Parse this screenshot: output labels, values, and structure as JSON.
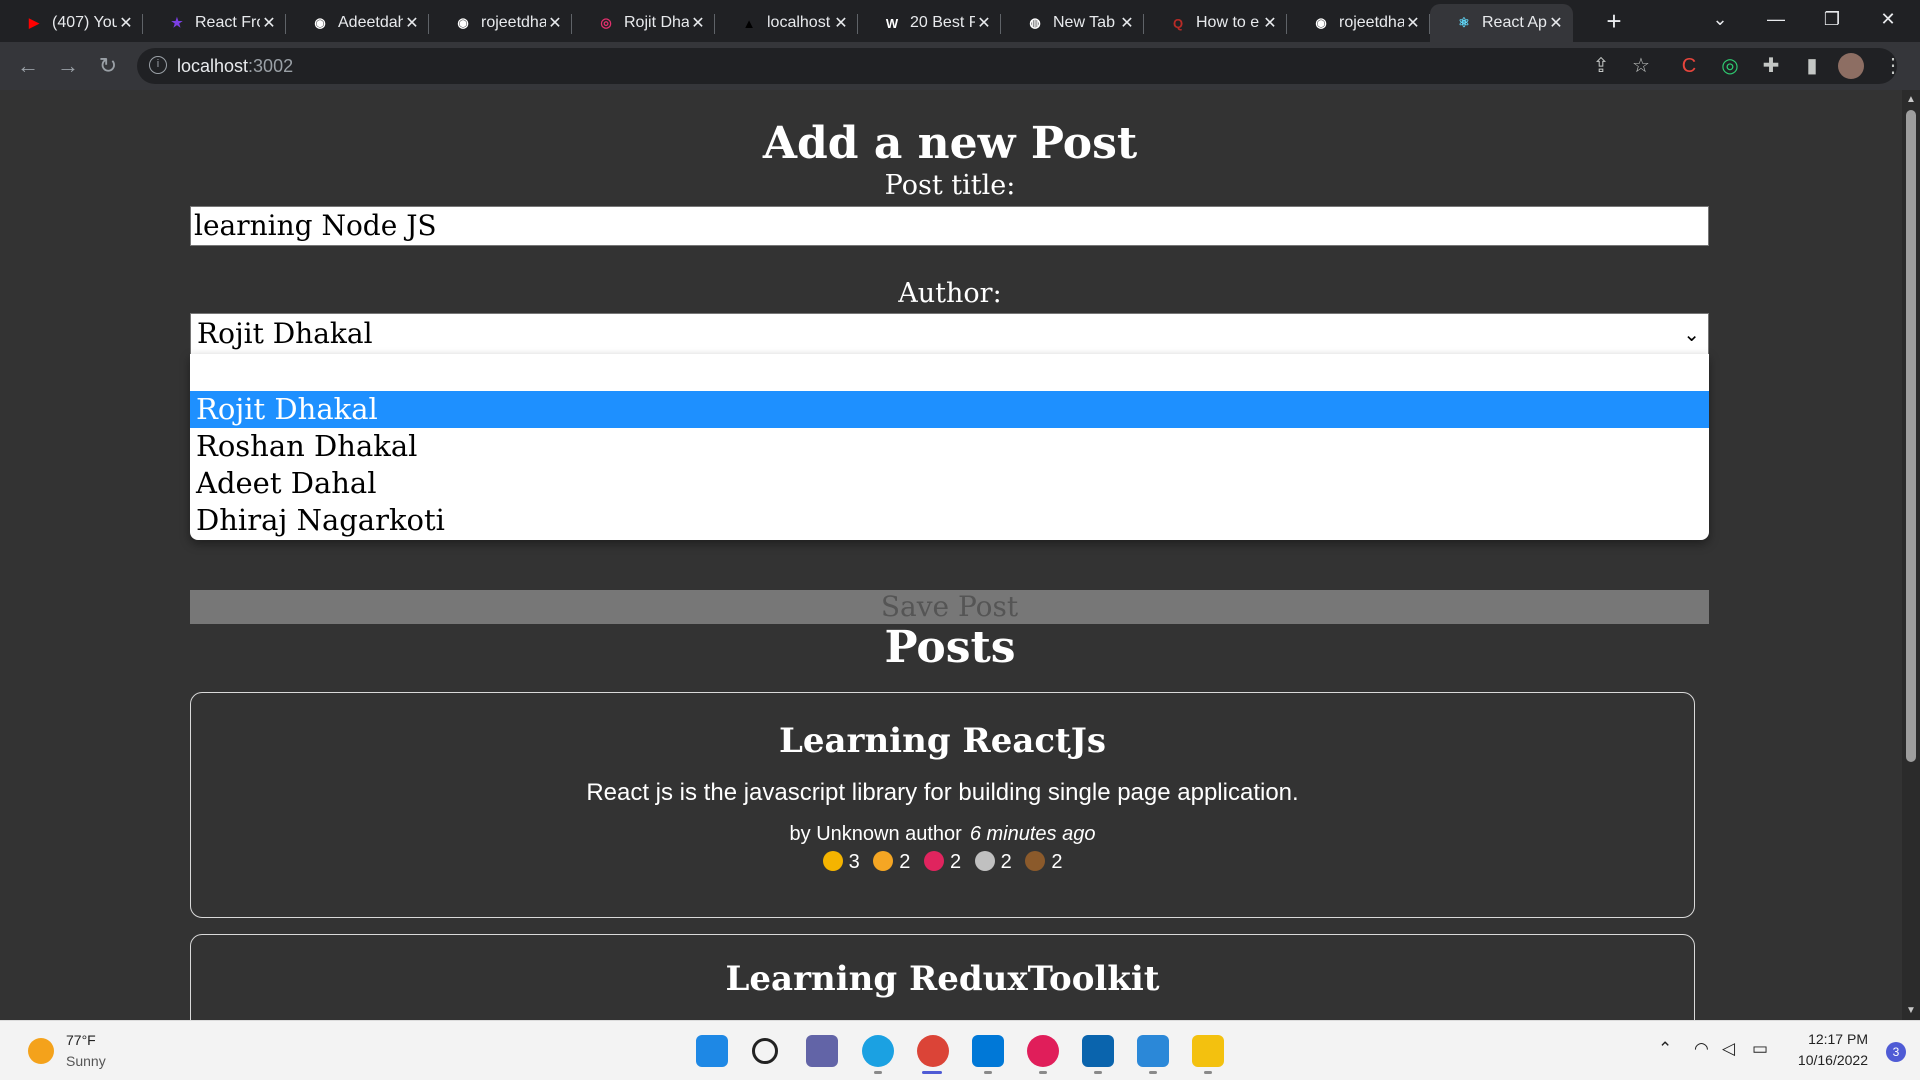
{
  "browser": {
    "tabs": [
      {
        "title": "(407) You",
        "icon": "youtube-icon",
        "color": "#ff0000",
        "glyph": "▶"
      },
      {
        "title": "React Fro",
        "icon": "star-icon",
        "color": "#7b3fe4",
        "glyph": "★"
      },
      {
        "title": "Adeetdah",
        "icon": "github-icon",
        "color": "#ffffff",
        "glyph": "◉"
      },
      {
        "title": "rojeetdha",
        "icon": "github-icon",
        "color": "#ffffff",
        "glyph": "◉"
      },
      {
        "title": "Rojit Dha",
        "icon": "instagram-icon",
        "color": "#e1306c",
        "glyph": "◎"
      },
      {
        "title": "localhost",
        "icon": "triangle-icon",
        "color": "#000000",
        "glyph": "▲"
      },
      {
        "title": "20 Best P",
        "icon": "wix-icon",
        "color": "#ffffff",
        "glyph": "W"
      },
      {
        "title": "New Tab",
        "icon": "chrome-icon",
        "color": "#ffffff",
        "glyph": "◍"
      },
      {
        "title": "How to e",
        "icon": "quora-icon",
        "color": "#b92b27",
        "glyph": "Q"
      },
      {
        "title": "rojeetdha",
        "icon": "github-icon",
        "color": "#ffffff",
        "glyph": "◉"
      },
      {
        "title": "React App",
        "icon": "react-icon",
        "color": "#61dafb",
        "glyph": "⚛"
      }
    ],
    "new_tab": "+",
    "url_host": "localhost",
    "url_port": ":3002"
  },
  "form": {
    "heading": "Add a new Post",
    "title_label": "Post title:",
    "title_value": "learning Node JS",
    "author_label": "Author:",
    "author_selected": "Rojit Dhakal",
    "author_options": [
      "",
      "Rojit Dhakal",
      "Roshan Dhakal",
      "Adeet Dahal",
      "Dhiraj Nagarkoti"
    ],
    "save_label": "Save Post"
  },
  "posts_heading": "Posts",
  "posts": [
    {
      "title": "Learning ReactJs",
      "body": "React js is the javascript library for building single page application.",
      "author": "by Unknown author",
      "time": "6 minutes ago",
      "reactions": [
        {
          "icon": "thumbs-up-icon",
          "count": "3",
          "color": "#f5b400"
        },
        {
          "icon": "wow-icon",
          "count": "2",
          "color": "#f5a623"
        },
        {
          "icon": "heart-icon",
          "count": "2",
          "color": "#e0245e"
        },
        {
          "icon": "rocket-icon",
          "count": "2",
          "color": "#c0c0c0"
        },
        {
          "icon": "coffee-icon",
          "count": "2",
          "color": "#8b5a2b"
        }
      ]
    },
    {
      "title": "Learning ReduxToolkit"
    }
  ],
  "taskbar": {
    "temperature": "77°F",
    "weather": "Sunny",
    "time": "12:17 PM",
    "date": "10/16/2022",
    "notifications": "3"
  }
}
